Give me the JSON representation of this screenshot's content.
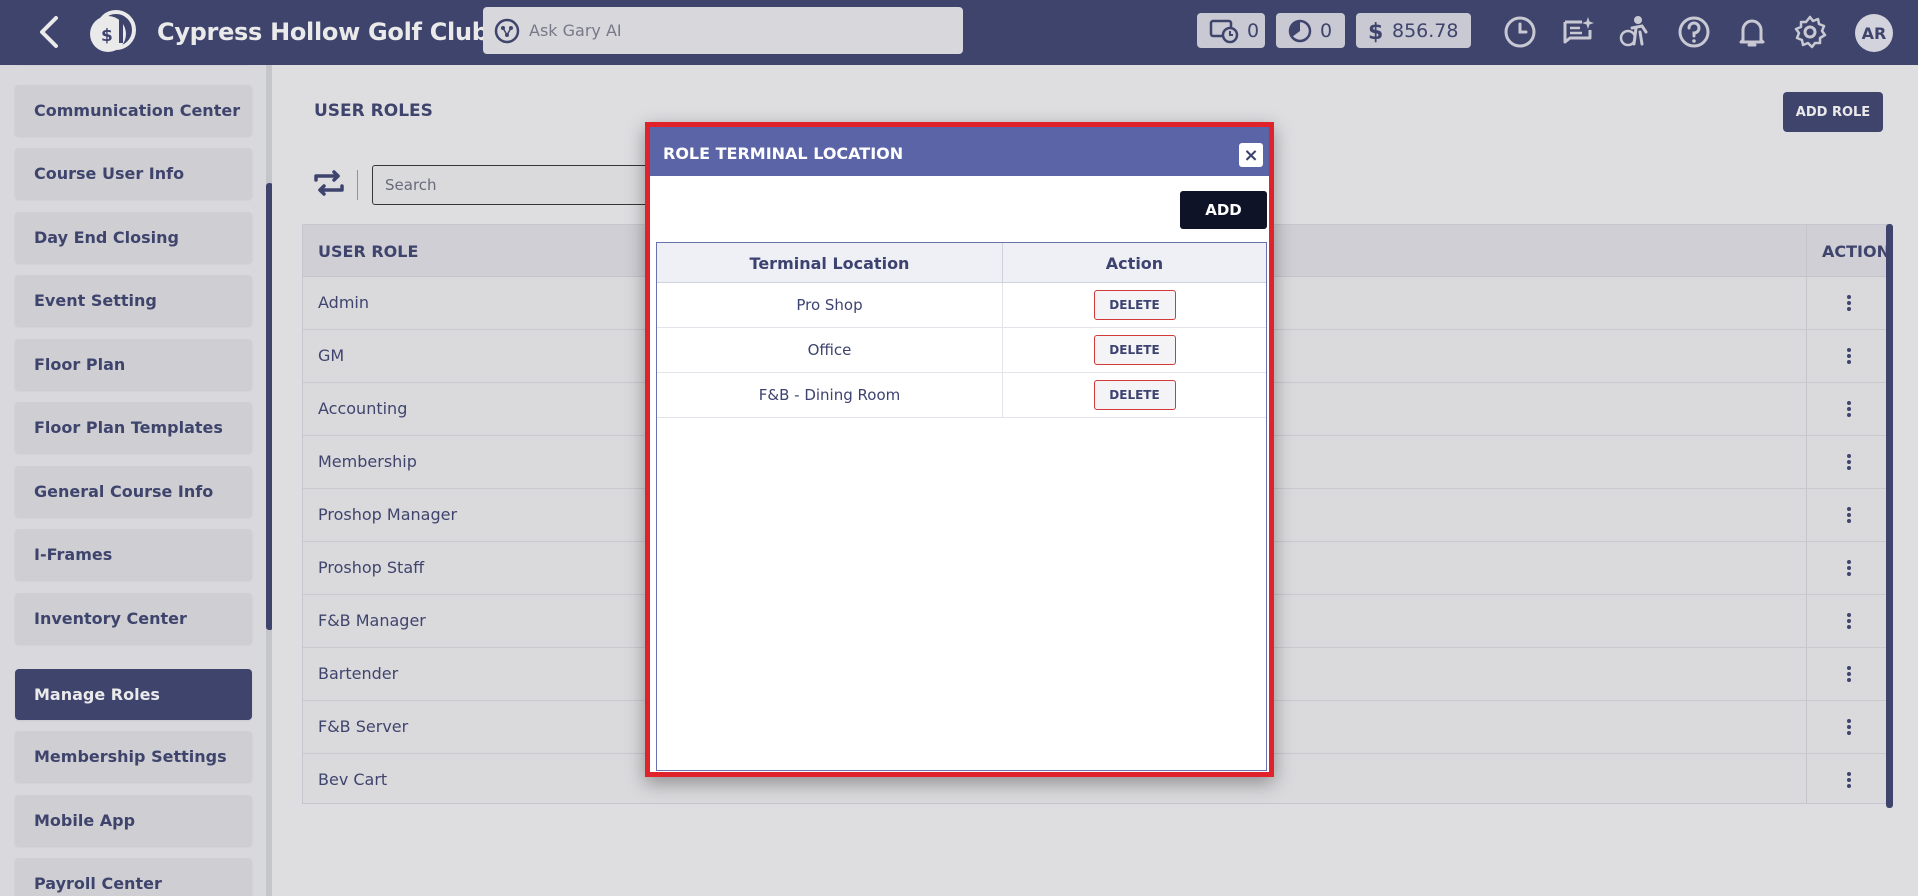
{
  "header": {
    "club_name": "Cypress Hollow Golf Club",
    "ask_placeholder": "Ask Gary AI",
    "tee_time_count": "0",
    "pie_count": "0",
    "balance": "856.78",
    "avatar_initials": "AR"
  },
  "sidebar": {
    "items": [
      {
        "label": "Communication Center"
      },
      {
        "label": "Course User Info"
      },
      {
        "label": "Day End Closing"
      },
      {
        "label": "Event Setting"
      },
      {
        "label": "Floor Plan"
      },
      {
        "label": "Floor Plan Templates"
      },
      {
        "label": "General Course Info"
      },
      {
        "label": "I-Frames"
      },
      {
        "label": "Inventory Center"
      },
      {
        "label": "Manage Roles"
      },
      {
        "label": "Membership Settings"
      },
      {
        "label": "Mobile App"
      },
      {
        "label": "Payroll Center"
      }
    ],
    "active": "Manage Roles"
  },
  "main": {
    "title": "USER ROLES",
    "add_role_label": "ADD ROLE",
    "search_placeholder": "Search",
    "columns": {
      "role": "USER ROLE",
      "action": "ACTION"
    },
    "rows": [
      "Admin",
      "GM",
      "Accounting",
      "Membership",
      "Proshop Manager",
      "Proshop Staff",
      "F&B Manager",
      "Bartender",
      "F&B Server",
      "Bev Cart"
    ]
  },
  "modal": {
    "title": "ROLE TERMINAL LOCATION",
    "close_label": "×",
    "add_label": "ADD",
    "columns": {
      "location": "Terminal Location",
      "action": "Action"
    },
    "rows": [
      {
        "location": "Pro Shop",
        "action": "DELETE"
      },
      {
        "location": "Office",
        "action": "DELETE"
      },
      {
        "location": "F&B - Dining Room",
        "action": "DELETE"
      }
    ]
  },
  "colors": {
    "brand": "#3d4370",
    "modal_header": "#5b64a7",
    "highlight_border": "#e0222b"
  }
}
